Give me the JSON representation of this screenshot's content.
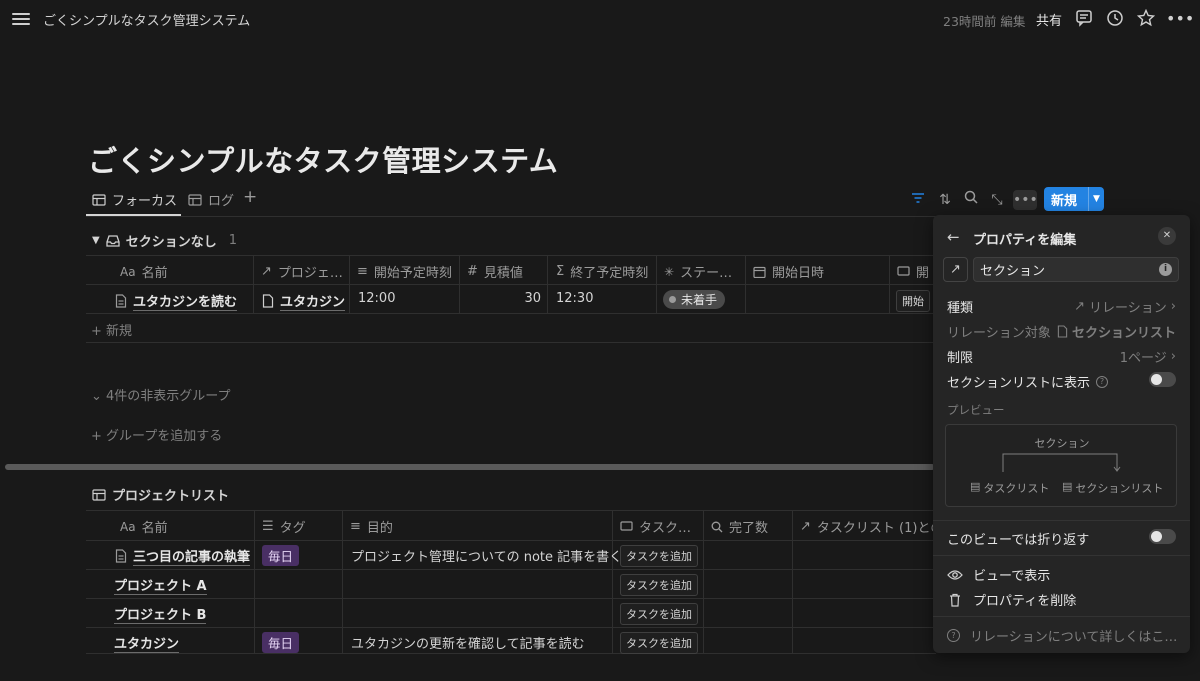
{
  "topbar": {
    "doc_title": "ごくシンプルなタスク管理システム",
    "edited": "23時間前 編集",
    "share": "共有"
  },
  "page": {
    "title": "ごくシンプルなタスク管理システム",
    "tabs": [
      {
        "label": "フォーカス",
        "active": true
      },
      {
        "label": "ログ",
        "active": false
      }
    ],
    "new_button": "新規"
  },
  "group": {
    "name": "セクションなし",
    "count": "1",
    "hidden_groups": "4件の非表示グループ",
    "add_group": "グループを追加する",
    "add_new": "新規"
  },
  "tasks_table": {
    "headers": [
      "名前",
      "プロジェ…",
      "開始予定時刻",
      "見積値",
      "終了予定時刻",
      "ステー…",
      "開始日時",
      "開"
    ],
    "header_prefixes": [
      "Aa",
      "↗",
      "≡",
      "#",
      "Σ",
      "",
      "",
      ""
    ],
    "rows": [
      {
        "name": "ユタカジンを読む",
        "project": "ユタカジン",
        "start_plan": "12:00",
        "estimate": "30",
        "end_plan": "12:30",
        "status": "未着手",
        "start_dt": "",
        "action": "開始"
      }
    ]
  },
  "projects": {
    "title": "プロジェクトリスト",
    "headers": [
      "名前",
      "タグ",
      "目的",
      "タスク…",
      "完了数",
      "タスクリスト (1)との"
    ],
    "header_prefixes": [
      "Aa",
      "",
      "",
      "",
      "",
      "↗"
    ],
    "rows": [
      {
        "name": "三つ目の記事の執筆",
        "tag": "毎日",
        "purpose": "プロジェクト管理についての note 記事を書く",
        "button": "タスクを追加"
      },
      {
        "name": "プロジェクト A",
        "tag": "",
        "purpose": "",
        "button": "タスクを追加"
      },
      {
        "name": "プロジェクト B",
        "tag": "",
        "purpose": "",
        "button": "タスクを追加"
      },
      {
        "name": "ユタカジン",
        "tag": "毎日",
        "purpose": "ユタカジンの更新を確認して記事を読む",
        "button": "タスクを追加"
      }
    ]
  },
  "panel": {
    "title": "プロパティを編集",
    "property_name": "セクション",
    "type_label": "種類",
    "type_value": "リレーション",
    "target_label": "リレーション対象",
    "target_value": "セクションリスト",
    "limit_label": "制限",
    "limit_value": "1ページ",
    "show_in_label": "セクションリストに表示",
    "preview_label": "プレビュー",
    "preview_top": "セクション",
    "preview_left": "タスクリスト",
    "preview_right": "セクションリスト",
    "wrap_label": "このビューでは折り返す",
    "show_in_view": "ビューで表示",
    "delete_property": "プロパティを削除",
    "learn_more": "リレーションについて詳しくはこ…"
  },
  "colors": {
    "background": "#191919",
    "accent": "#2383e2",
    "tag_purple": "#492f64"
  }
}
